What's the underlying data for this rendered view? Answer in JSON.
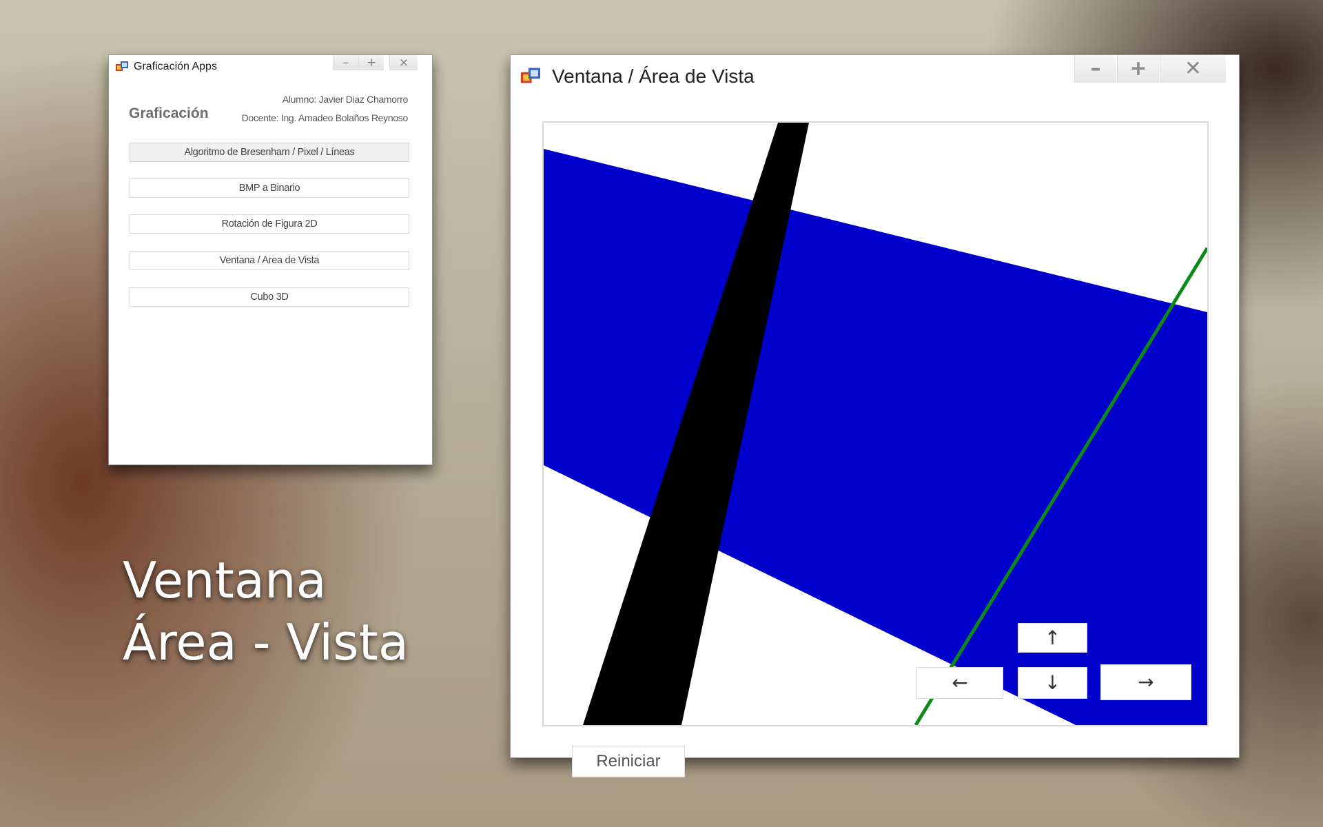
{
  "apps_window": {
    "title": "Graficación Apps",
    "controls": {
      "minimize": "–",
      "maximize": "+",
      "close": "×"
    },
    "brand": "Graficación",
    "student": "Alumno: Javier Diaz Chamorro",
    "teacher": "Docente: Ing. Amadeo Bolaños  Reynoso",
    "menu": [
      {
        "label": "Algoritmo de Bresenham / Pixel / Líneas"
      },
      {
        "label": "BMP a Binario"
      },
      {
        "label": "Rotación de Figura 2D"
      },
      {
        "label": "Ventana / Area de Vista"
      },
      {
        "label": "Cubo 3D"
      }
    ]
  },
  "viewport_window": {
    "title": "Ventana / Área de Vista",
    "controls": {
      "minimize": "–",
      "maximize": "+",
      "close": "✕"
    },
    "reset_label": "Reiniciar",
    "nav": {
      "up": "↑",
      "down": "↓",
      "left": "←",
      "right": "→"
    },
    "colors": {
      "band": "#0000cc",
      "thick_line": "#000000",
      "thin_line": "#0a8a16",
      "background": "#ffffff"
    }
  },
  "caption": {
    "line1": "Ventana",
    "line2": "Área - Vista"
  }
}
